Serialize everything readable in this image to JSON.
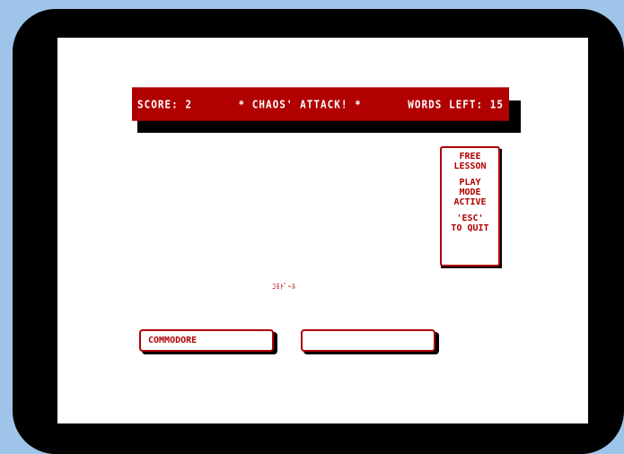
{
  "header": {
    "score": "SCORE: 2",
    "title": "* CHAOS' ATTACK! *",
    "words_left": "WORDS LEFT: 15"
  },
  "panel": {
    "line1": "FREE",
    "line2": "LESSON",
    "line3": "PLAY",
    "line4": "MODE",
    "line5": "ACTIVE",
    "line6": "'ESC'",
    "line7": "TO QUIT"
  },
  "hint": "ｺﾓﾄﾞｰﾙ",
  "input": {
    "typed": "COMMODORE",
    "answer": ""
  },
  "colors": {
    "accent": "#b00000",
    "bezel": "#000000",
    "background": "#9ec5e9"
  }
}
